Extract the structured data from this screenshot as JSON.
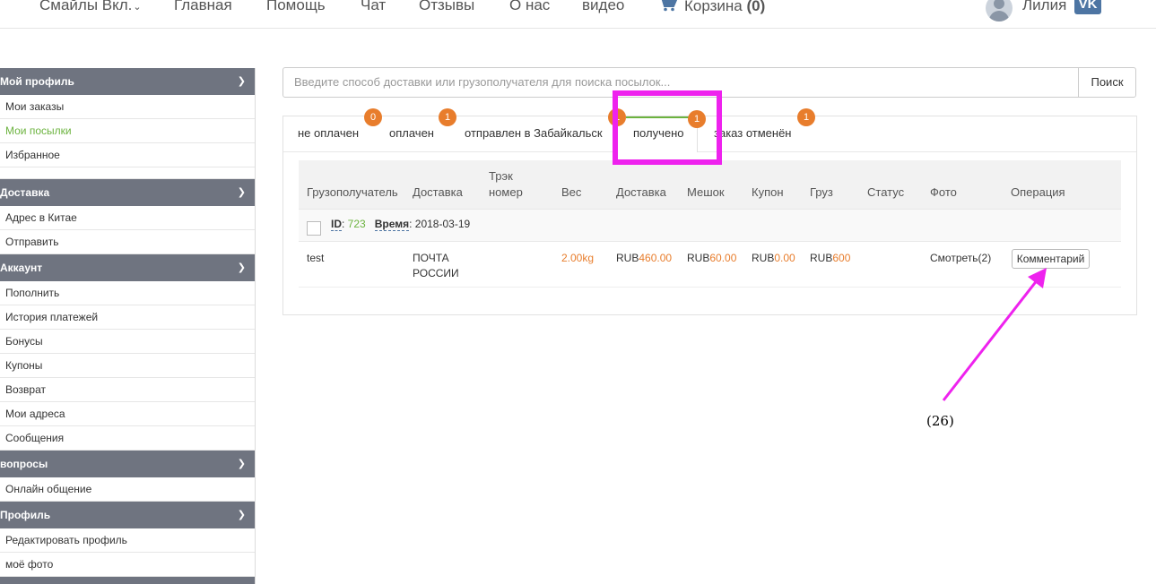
{
  "nav": {
    "brand": "Смайлы Вкл.",
    "brand_caret": "⌄",
    "items": [
      "Главная",
      "Помощь",
      "Чат",
      "Отзывы",
      "О нас",
      "видео"
    ],
    "cart_label": "Корзина",
    "cart_count": "(0)",
    "user_name": "Лилия",
    "vk_label": "VK"
  },
  "sidebar": {
    "sections": [
      {
        "title": "Мой профиль",
        "items": [
          "Мои заказы",
          "Мои посылки",
          "Избранное"
        ],
        "active": "Мои посылки"
      },
      {
        "title": "Доставка",
        "items": [
          "Адрес в Китае",
          "Отправить"
        ]
      },
      {
        "title": "Аккаунт",
        "items": [
          "Пополнить",
          "История платежей",
          "Бонусы",
          "Купоны",
          "Возврат",
          "Мои адреса",
          "Сообщения"
        ]
      },
      {
        "title": "вопросы",
        "items": [
          "Онлайн общение"
        ]
      },
      {
        "title": "Профиль",
        "items": [
          "Редактировать профиль",
          "моё фото"
        ]
      }
    ]
  },
  "search": {
    "placeholder": "Введите способ доставки или грузополучателя для поиска посылок...",
    "button": "Поиск"
  },
  "tabs": [
    {
      "label": "не оплачен",
      "count": "0"
    },
    {
      "label": "оплачен",
      "count": "1"
    },
    {
      "label": "отправлен в Забайкальск",
      "count": "1"
    },
    {
      "label": "получено",
      "count": "1",
      "active": true
    },
    {
      "label": "заказ отменён",
      "count": "1"
    }
  ],
  "table": {
    "headers": [
      "Грузополучатель",
      "Доставка",
      "Трэк номер",
      "Вес",
      "Доставка",
      "Мешок",
      "Купон",
      "Груз",
      "Статус",
      "Фото",
      "Операция"
    ],
    "header_track_lines": [
      "Трэк",
      "номер"
    ],
    "order": {
      "id_label": "ID",
      "id": "723",
      "time_label": "Время",
      "time": "2018-03-19"
    },
    "row": {
      "recipient": "test",
      "delivery_lines": [
        "ПОЧТА",
        "РОССИИ"
      ],
      "weight": "2.00kg",
      "currency": "RUB",
      "shipping": "460.00",
      "bag": "60.00",
      "coupon": "0.00",
      "cargo": "600",
      "photo": "Смотреть(2)",
      "operation": "Комментарий"
    }
  },
  "annotation": {
    "label": "(26)",
    "color": "#ee22ee"
  },
  "colors": {
    "accent_green": "#6cb33f",
    "badge_orange": "#e87d2c",
    "sidebar_header": "#6f7480"
  }
}
